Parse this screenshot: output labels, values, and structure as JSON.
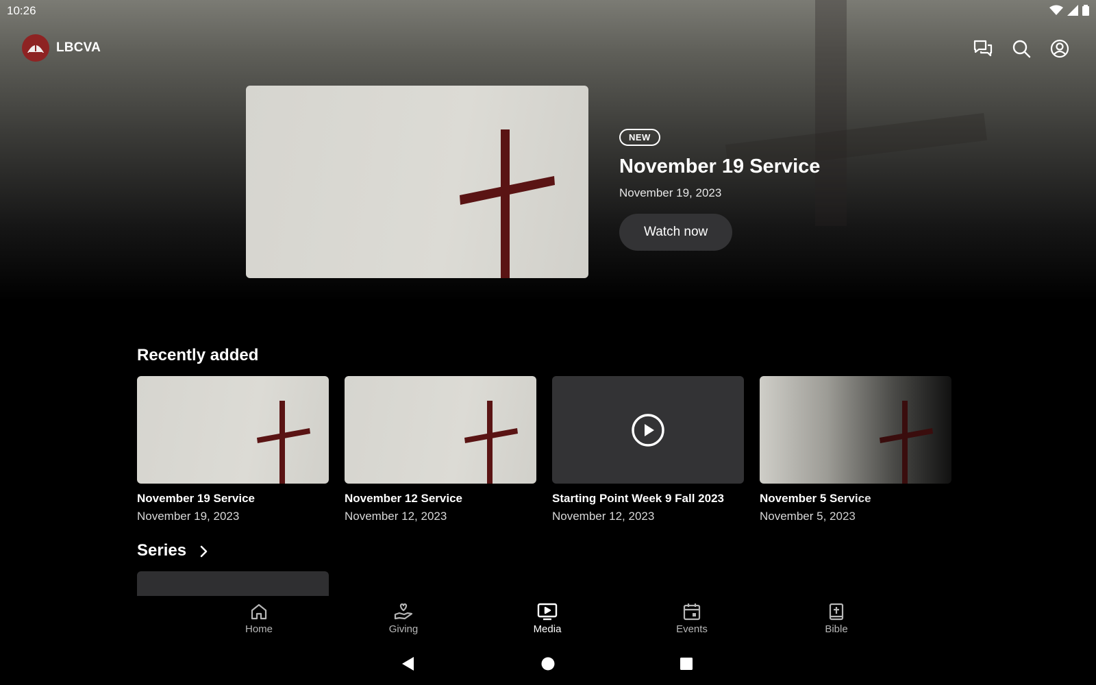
{
  "status_bar": {
    "time": "10:26"
  },
  "app": {
    "title": "LBCVA"
  },
  "header_icons": [
    "chat-icon",
    "search-icon",
    "account-icon"
  ],
  "featured": {
    "badge": "NEW",
    "title": "November 19 Service",
    "date": "November 19, 2023",
    "watch_label": "Watch now"
  },
  "recently_added": {
    "title": "Recently added",
    "items": [
      {
        "title": "November 19 Service",
        "date": "November 19, 2023",
        "thumb": "cross"
      },
      {
        "title": "November 12 Service",
        "date": "November 12, 2023",
        "thumb": "cross"
      },
      {
        "title": "Starting Point Week 9 Fall 2023",
        "date": "November 12, 2023",
        "thumb": "play-icon"
      },
      {
        "title": "November 5 Service",
        "date": "November 5, 2023",
        "thumb": "cross"
      }
    ]
  },
  "series": {
    "title": "Series"
  },
  "bottom_nav": {
    "items": [
      {
        "label": "Home",
        "icon": "home-icon"
      },
      {
        "label": "Giving",
        "icon": "giving-icon"
      },
      {
        "label": "Media",
        "icon": "media-icon",
        "active": true
      },
      {
        "label": "Events",
        "icon": "calendar-icon"
      },
      {
        "label": "Bible",
        "icon": "bible-icon"
      }
    ]
  },
  "colors": {
    "background": "#000000",
    "surface": "#333335",
    "accent": "#8e2323",
    "cross": "#5a1414"
  }
}
